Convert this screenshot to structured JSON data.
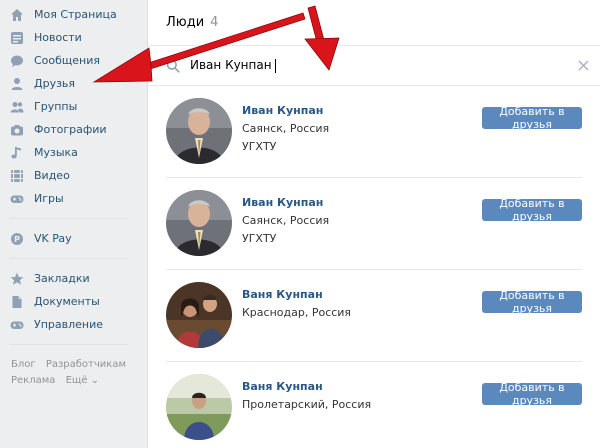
{
  "sidebar": {
    "items": [
      {
        "label": "Моя Страница",
        "icon": "home-icon"
      },
      {
        "label": "Новости",
        "icon": "news-icon"
      },
      {
        "label": "Сообщения",
        "icon": "messages-icon"
      },
      {
        "label": "Друзья",
        "icon": "friends-icon"
      },
      {
        "label": "Группы",
        "icon": "groups-icon"
      },
      {
        "label": "Фотографии",
        "icon": "camera-icon"
      },
      {
        "label": "Музыка",
        "icon": "music-icon"
      },
      {
        "label": "Видео",
        "icon": "video-icon"
      },
      {
        "label": "Игры",
        "icon": "gamepad-icon"
      }
    ],
    "pay": {
      "label": "VK Pay",
      "icon": "vkpay-icon"
    },
    "extra": [
      {
        "label": "Закладки",
        "icon": "star-icon"
      },
      {
        "label": "Документы",
        "icon": "document-icon"
      },
      {
        "label": "Управление",
        "icon": "gamepad-icon"
      }
    ],
    "footer": {
      "blog": "Блог",
      "developers": "Разработчикам",
      "ads": "Реклама",
      "more": "Ещё ⌄"
    }
  },
  "main": {
    "header": {
      "title": "Люди",
      "count": "4"
    },
    "search": {
      "value": "Иван Кунпан"
    },
    "results": [
      {
        "name": "Иван Кунпан",
        "city": "Саянск, Россия",
        "extra": "УГХТУ",
        "button": "Добавить в друзья"
      },
      {
        "name": "Иван Кунпан",
        "city": "Саянск, Россия",
        "extra": "УГХТУ",
        "button": "Добавить в друзья"
      },
      {
        "name": "Ваня Кунпан",
        "city": "Краснодар, Россия",
        "extra": "",
        "button": "Добавить в друзья"
      },
      {
        "name": "Ваня Кунпан",
        "city": "Пролетарский, Россия",
        "extra": "",
        "button": "Добавить в друзья"
      }
    ]
  },
  "colors": {
    "link": "#2a5885",
    "nav": "#285473",
    "button": "#5b88bd",
    "arrow": "#d9141a"
  }
}
